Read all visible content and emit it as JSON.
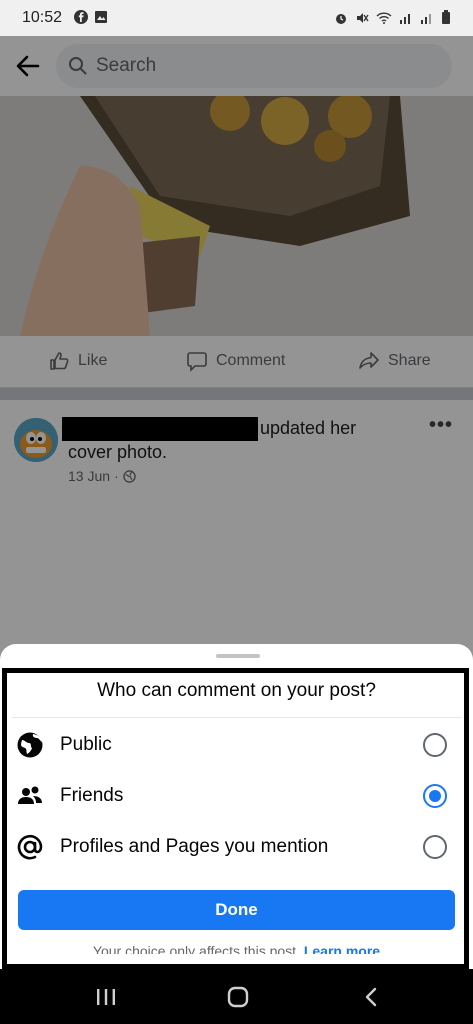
{
  "status_bar": {
    "time": "10:52",
    "left_icons": [
      "facebook-icon",
      "image-icon"
    ],
    "right_icons": [
      "alarm-icon",
      "mute-icon",
      "wifi-icon",
      "signal-icon",
      "signal-icon",
      "battery-icon"
    ]
  },
  "header": {
    "search_placeholder": "Search"
  },
  "post_actions": {
    "like": "Like",
    "comment": "Comment",
    "share": "Share"
  },
  "post": {
    "text_line1": "updated her",
    "text_line2": "cover photo.",
    "date": "13 Jun",
    "separator": "·"
  },
  "sheet": {
    "title": "Who can comment on your post?",
    "options": [
      {
        "label": "Public",
        "icon": "globe-icon",
        "selected": false
      },
      {
        "label": "Friends",
        "icon": "friends-icon",
        "selected": true
      },
      {
        "label": "Profiles and Pages you mention",
        "icon": "at-icon",
        "selected": false
      }
    ],
    "done_label": "Done",
    "footnote": "Your choice only affects this post.",
    "footnote_link": "Learn more"
  },
  "colors": {
    "accent": "#1877f2",
    "dim_overlay": "rgba(0,0,0,0.42)"
  }
}
